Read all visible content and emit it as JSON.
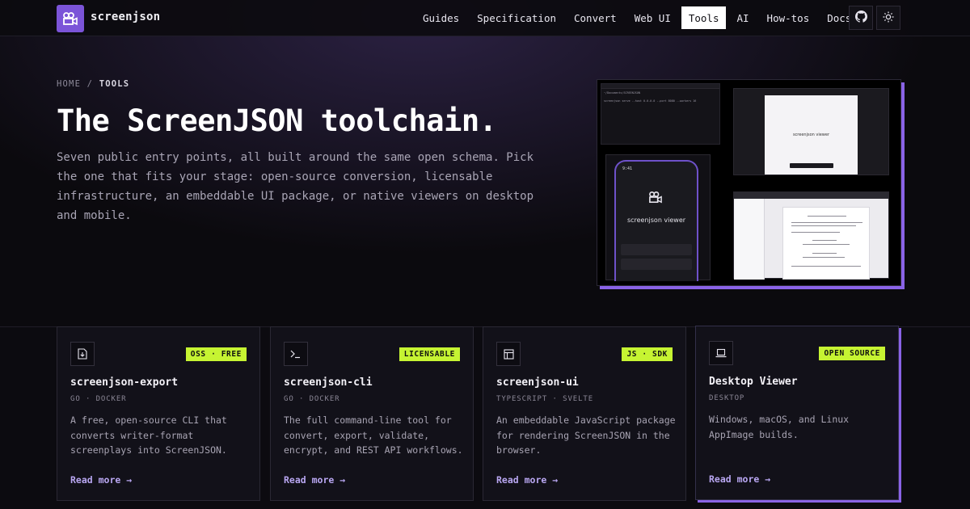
{
  "nav": {
    "brand": "screenjson",
    "links": [
      {
        "label": "Guides"
      },
      {
        "label": "Specification"
      },
      {
        "label": "Convert"
      },
      {
        "label": "Web UI"
      },
      {
        "label": "Tools",
        "active": true
      },
      {
        "label": "AI"
      },
      {
        "label": "How-tos"
      },
      {
        "label": "Docs",
        "external": true
      }
    ],
    "icons": [
      "github-icon",
      "theme-toggle-icon"
    ]
  },
  "breadcrumb": {
    "home": "HOME",
    "separator": "/",
    "current": "TOOLS"
  },
  "hero": {
    "title": "The ScreenJSON toolchain.",
    "description": "Seven public entry points, all built around the same open schema. Pick the one that fits your stage: open-source conversion, licensable infrastructure, an embeddable UI package, or native viewers on desktop and mobile."
  },
  "collage": {
    "terminal_line1": "~/Documents/SCREENJSON",
    "terminal_line2": "screenjson serve --host 0.0.0.0 --port 8080 --workers 16",
    "viewer_label": "screenjson viewer",
    "phone_time": "9:41",
    "phone_label": "screenjson viewer"
  },
  "cards": [
    {
      "icon": "file-export-icon",
      "badge": "OSS · FREE",
      "title": "screenjson-export",
      "sub": "GO · DOCKER",
      "desc": "A free, open-source CLI that converts writer-format screenplays into ScreenJSON.",
      "link": "Read more →"
    },
    {
      "icon": "terminal-icon",
      "badge": "LICENSABLE",
      "title": "screenjson-cli",
      "sub": "GO · DOCKER",
      "desc": "The full command-line tool for convert, export, validate, encrypt, and REST API workflows.",
      "link": "Read more →"
    },
    {
      "icon": "layout-icon",
      "badge": "JS · SDK",
      "title": "screenjson-ui",
      "sub": "TYPESCRIPT · SVELTE",
      "desc": "An embeddable JavaScript package for rendering ScreenJSON in the browser.",
      "link": "Read more →"
    },
    {
      "icon": "laptop-icon",
      "badge": "OPEN SOURCE",
      "title": "Desktop Viewer",
      "sub": "DESKTOP",
      "desc": "Windows, macOS, and Linux AppImage builds.",
      "link": "Read more →"
    }
  ],
  "colors": {
    "accent": "#8a63e6",
    "badge": "#c6f432",
    "logo": "#7b54d8"
  }
}
